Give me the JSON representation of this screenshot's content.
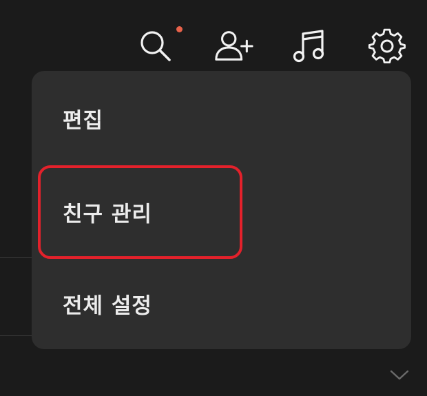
{
  "topbar": {
    "icons": [
      "search-icon",
      "add-friend-icon",
      "music-icon",
      "settings-icon"
    ],
    "notification_dot_color": "#e8624a"
  },
  "menu": {
    "items": [
      {
        "label": "편집"
      },
      {
        "label": "친구 관리",
        "highlighted": true
      },
      {
        "label": "전체 설정"
      }
    ]
  },
  "colors": {
    "background": "#1b1b1b",
    "menu_background": "#2e2e2e",
    "text": "#ececec",
    "highlight_border": "#e3212b",
    "icon": "#f2f2f2"
  }
}
